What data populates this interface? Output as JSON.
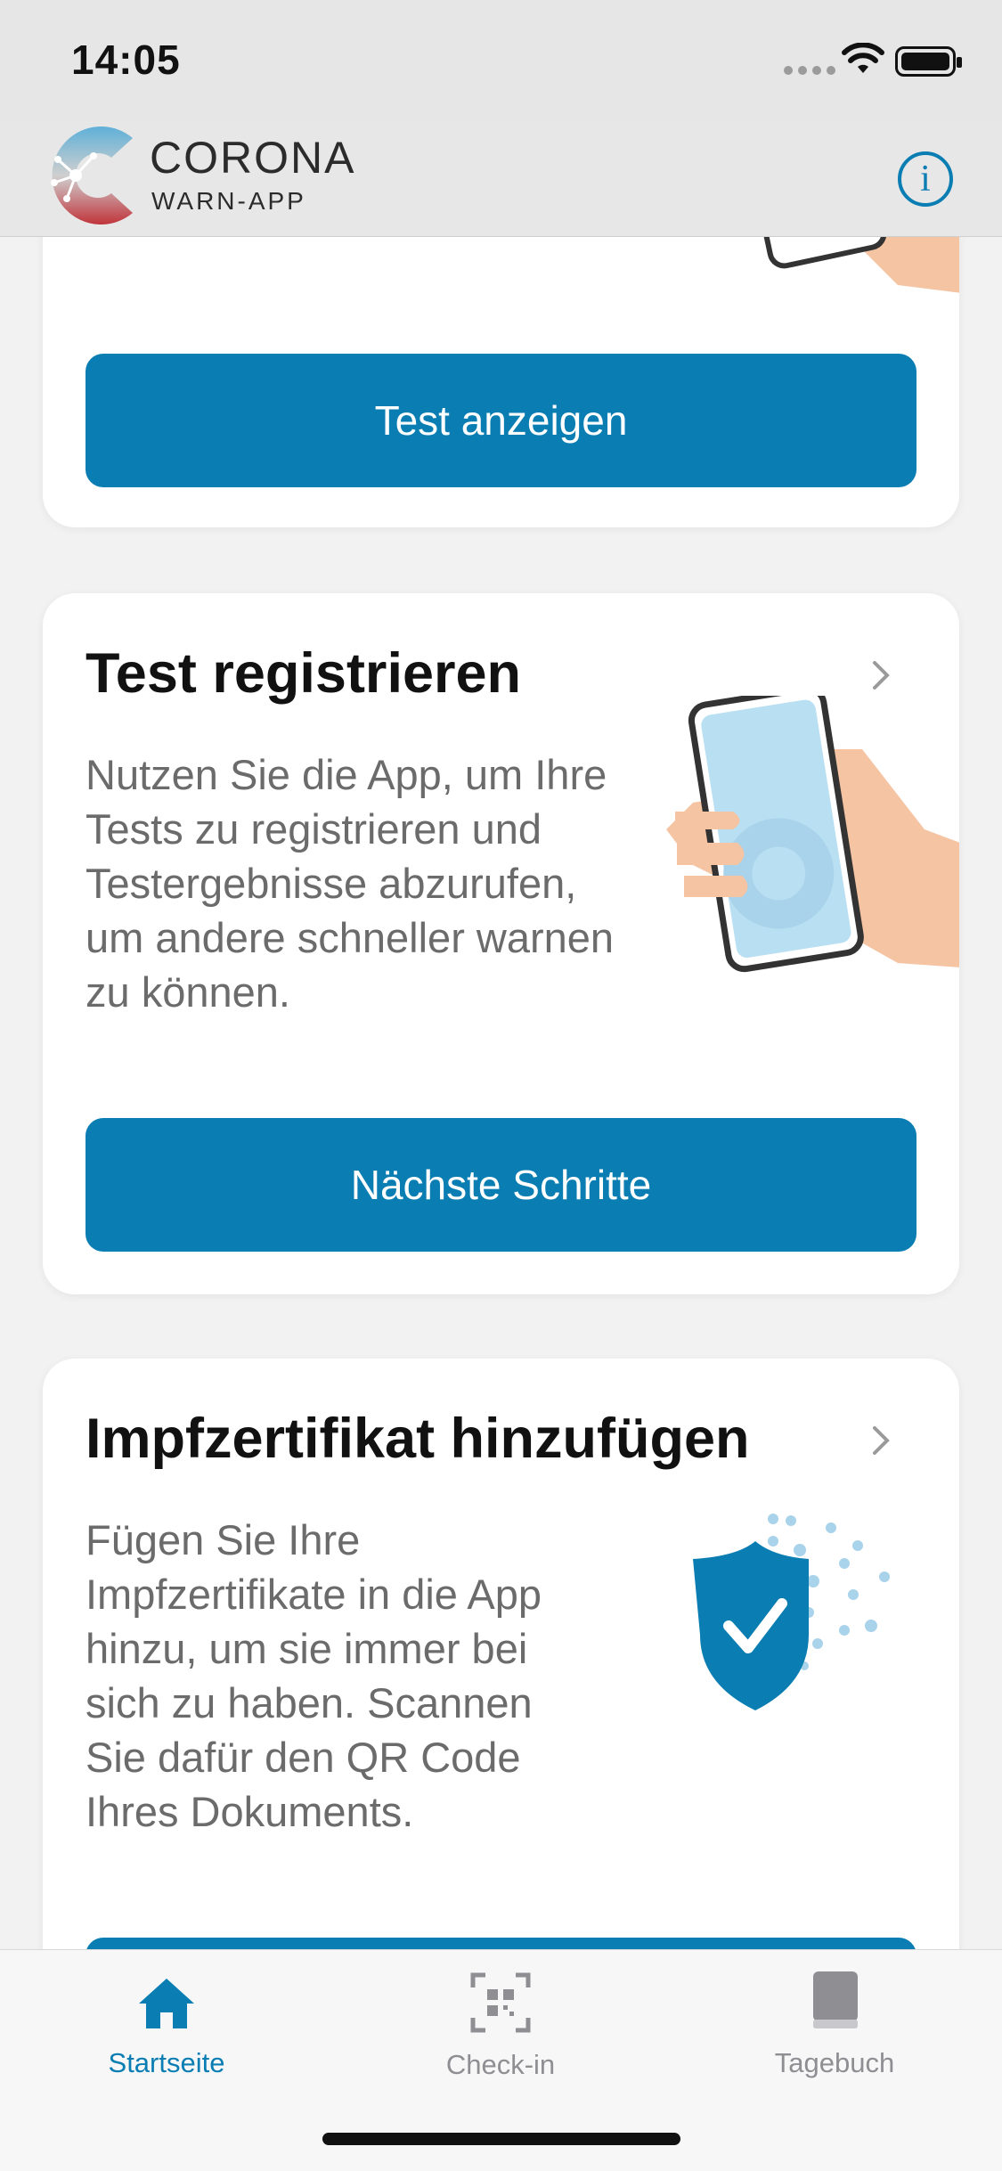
{
  "status_bar": {
    "time": "14:05"
  },
  "header": {
    "brand_line1": "CORONA",
    "brand_line2": "WARN-APP"
  },
  "cards": {
    "first": {
      "button_label": "Test anzeigen"
    },
    "test_register": {
      "title": "Test registrieren",
      "description": "Nutzen Sie die App, um Ihre Tests zu registrieren und Testergebnisse abzurufen, um andere schneller warnen zu können.",
      "button_label": "Nächste Schritte"
    },
    "vaccination": {
      "title": "Impfzertifikat hinzufügen",
      "description": "Fügen Sie Ihre Impfzertifikate in die App hinzu, um sie immer bei sich zu haben. Scannen Sie dafür den QR Code Ihres Dokuments."
    }
  },
  "tab_bar": {
    "tabs": [
      {
        "label": "Startseite",
        "icon": "home-icon",
        "active": true
      },
      {
        "label": "Check-in",
        "icon": "qr-scan-icon",
        "active": false
      },
      {
        "label": "Tagebuch",
        "icon": "book-icon",
        "active": false
      }
    ]
  },
  "colors": {
    "accent": "#0a7db3",
    "card_bg": "#ffffff",
    "page_bg": "#f2f2f2"
  }
}
